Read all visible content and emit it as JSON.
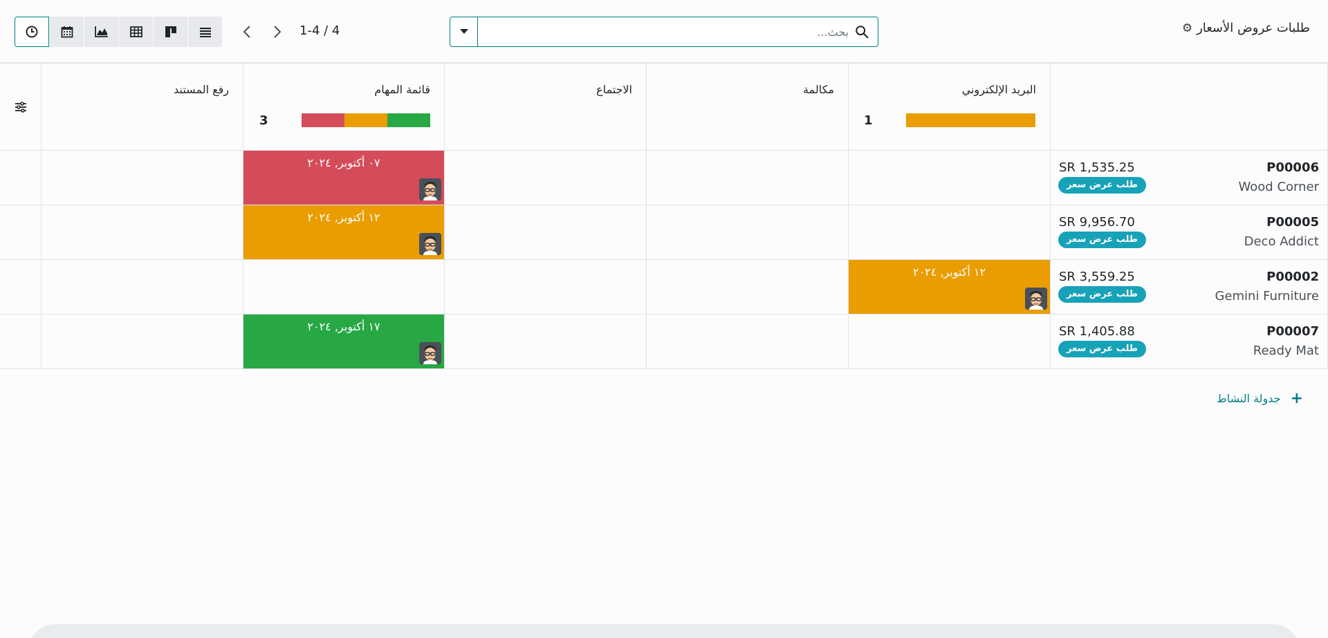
{
  "control_panel": {
    "title": "طلبات عروض الأسعار",
    "search_placeholder": "بحث...",
    "pager": "1-4 / 4"
  },
  "views": [
    "activity",
    "calendar",
    "graph",
    "pivot",
    "kanban",
    "list"
  ],
  "columns": [
    {
      "label": "البريد الإلكتروني",
      "count": "1",
      "progress": [
        {
          "color": "#e99d00",
          "value": 1
        }
      ]
    },
    {
      "label": "مكالمة",
      "count": "",
      "progress": []
    },
    {
      "label": "الاجتماع",
      "count": "",
      "progress": []
    },
    {
      "label": "قائمة المهام",
      "count": "3",
      "progress": [
        {
          "color": "#d44c59",
          "value": 1
        },
        {
          "color": "#e99d00",
          "value": 1
        },
        {
          "color": "#28a745",
          "value": 1
        }
      ]
    },
    {
      "label": "رفع المستند",
      "count": "",
      "progress": []
    }
  ],
  "rows": [
    {
      "ref": "P00006",
      "partner": "Wood Corner",
      "amount": "SR 1,535.25",
      "status": "طلب عرض سعر",
      "activity": {
        "col": 3,
        "date": "٠٧ أكتوبر, ٢٠٢٤",
        "color": "#d44c59"
      }
    },
    {
      "ref": "P00005",
      "partner": "Deco Addict",
      "amount": "SR 9,956.70",
      "status": "طلب عرض سعر",
      "activity": {
        "col": 3,
        "date": "١٢ أكتوبر, ٢٠٢٤",
        "color": "#e99d00"
      }
    },
    {
      "ref": "P00002",
      "partner": "Gemini Furniture",
      "amount": "SR 3,559.25",
      "status": "طلب عرض سعر",
      "activity": {
        "col": 0,
        "date": "١٢ أكتوبر, ٢٠٢٤",
        "color": "#e99d00"
      }
    },
    {
      "ref": "P00007",
      "partner": "Ready Mat",
      "amount": "SR 1,405.88",
      "status": "طلب عرض سعر",
      "activity": {
        "col": 3,
        "date": "١٧ أكتوبر, ٢٠٢٤",
        "color": "#28a745"
      }
    }
  ],
  "footer": {
    "schedule_activity": "جدولة النشاط"
  }
}
